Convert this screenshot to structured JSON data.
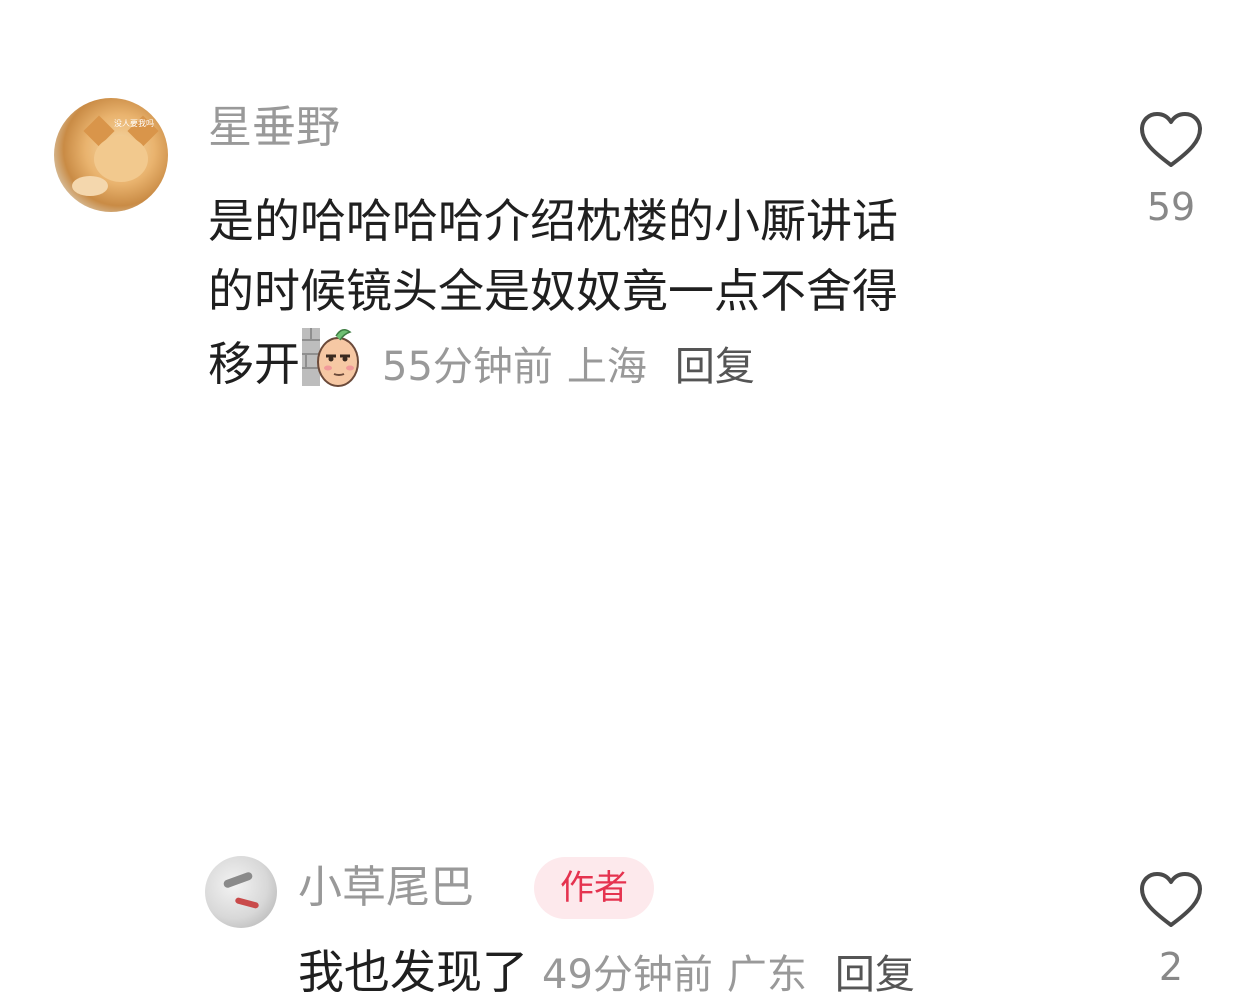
{
  "comments": [
    {
      "username": "星垂野",
      "avatar": "cat-photo-avatar",
      "avatar_text": "没人要我吗",
      "body_lines": [
        "是的哈哈哈哈介绍枕楼的小厮讲话",
        "的时候镜头全是奴奴竟一点不舍得",
        "移开"
      ],
      "sticker": "peeking-sticker",
      "time": "55分钟前",
      "location": "上海",
      "reply_label": "回复",
      "like_icon": "heart-outline-icon",
      "like_count": "59"
    },
    {
      "username": "小草尾巴",
      "avatar": "ink-painting-avatar",
      "badge": "作者",
      "body": "我也发现了",
      "time": "49分钟前",
      "location": "广东",
      "reply_label": "回复",
      "like_icon": "heart-outline-icon",
      "like_count": "2"
    }
  ],
  "colors": {
    "text": "#1f1f1f",
    "meta": "#999999",
    "badge_bg": "#fde9ec",
    "badge_text": "#e5334f"
  }
}
